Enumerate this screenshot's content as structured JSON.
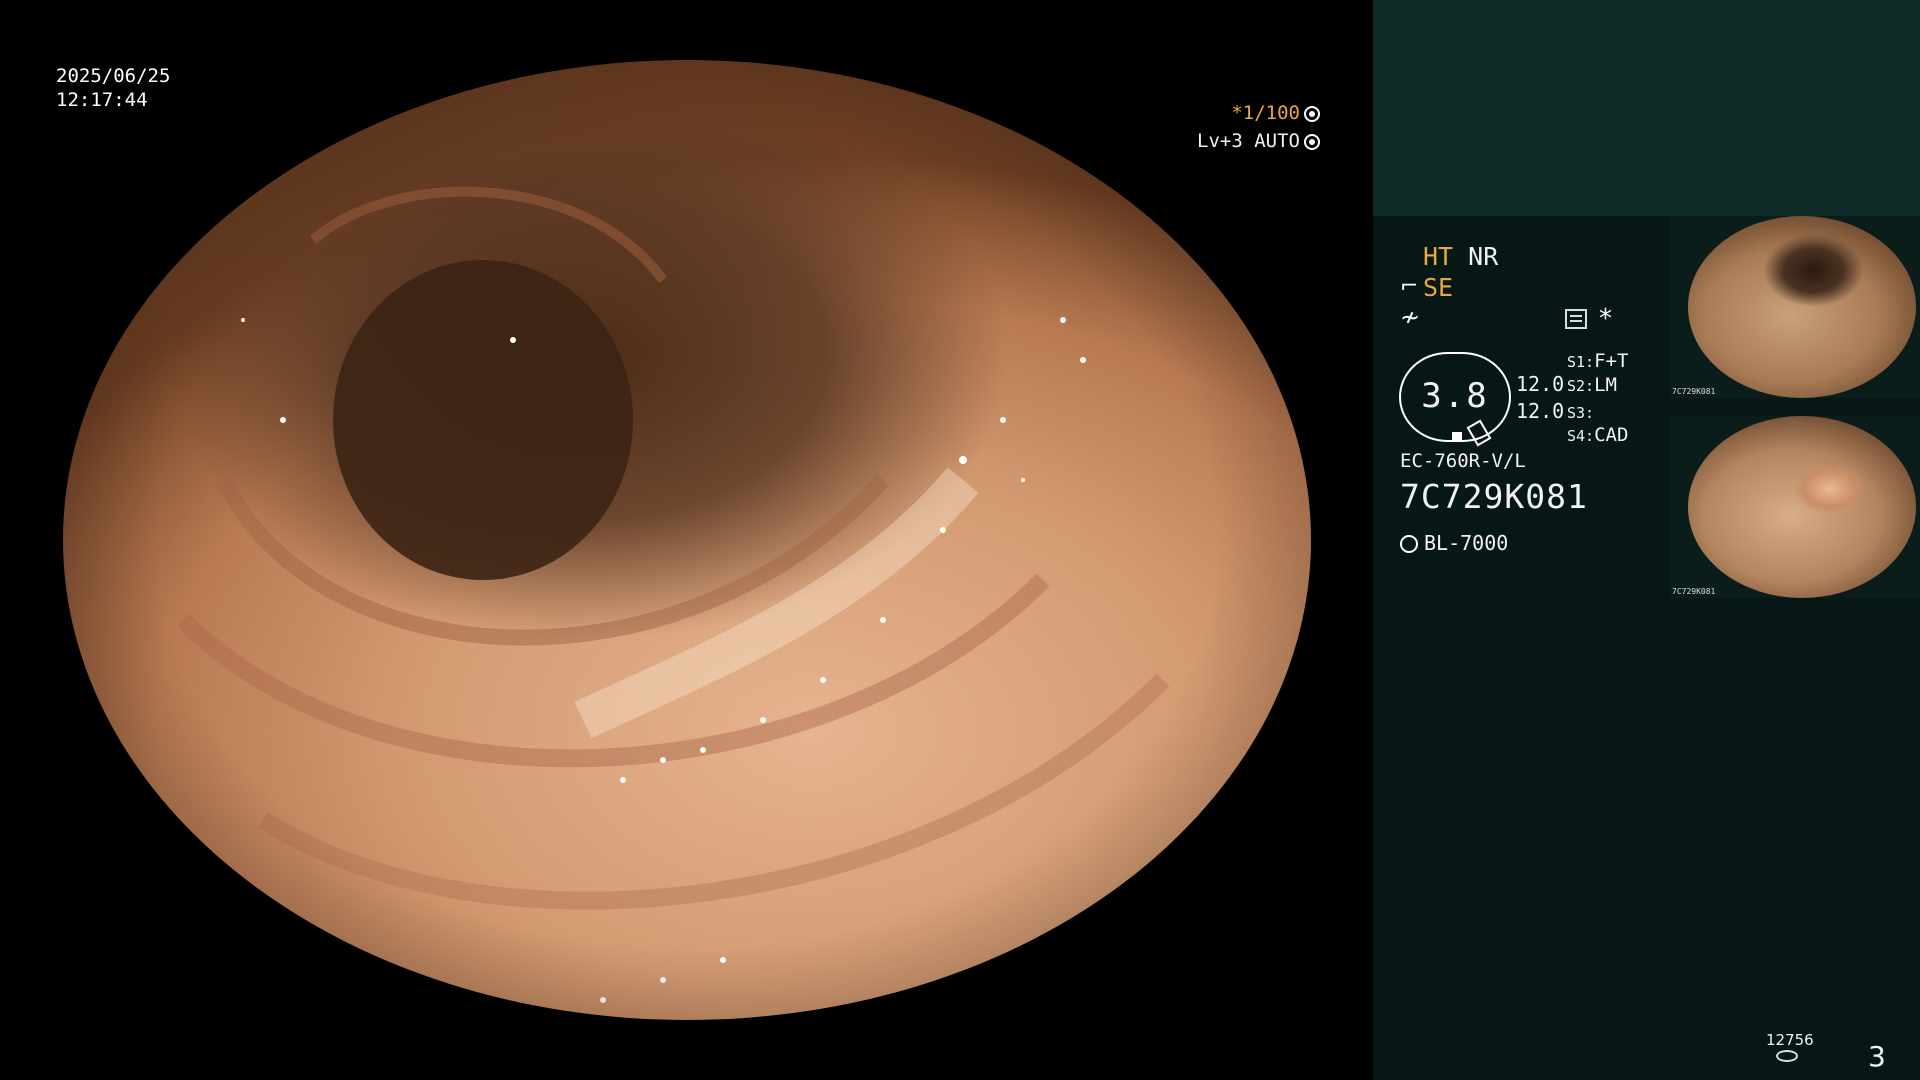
{
  "overlay": {
    "date": "2025/06/25",
    "time": "12:17:44",
    "shutter": "*1/100",
    "level": "Lv+3",
    "mode": "AUTO"
  },
  "panel": {
    "ht": "HT",
    "nr": "NR",
    "se": "SE",
    "brightness_value": "3.8",
    "value_1": "12.0",
    "value_2": "12.0",
    "slots": [
      {
        "key": "S1:",
        "value": "F+T"
      },
      {
        "key": "S2:",
        "value": "LM"
      },
      {
        "key": "S3:",
        "value": ""
      },
      {
        "key": "S4:",
        "value": "CAD"
      }
    ],
    "scope_model": "EC-760R-V/L",
    "scope_serial": "7C729K081",
    "light_source": "BL-7000"
  },
  "thumbnails": [
    {
      "caption": "7C729K081"
    },
    {
      "caption": "7C729K081"
    }
  ],
  "footer": {
    "image_count": "12756",
    "page_number": "3"
  },
  "colors": {
    "accent": "#e8a93c",
    "panel_top": "#0d2a27",
    "panel_body": "#061715"
  }
}
